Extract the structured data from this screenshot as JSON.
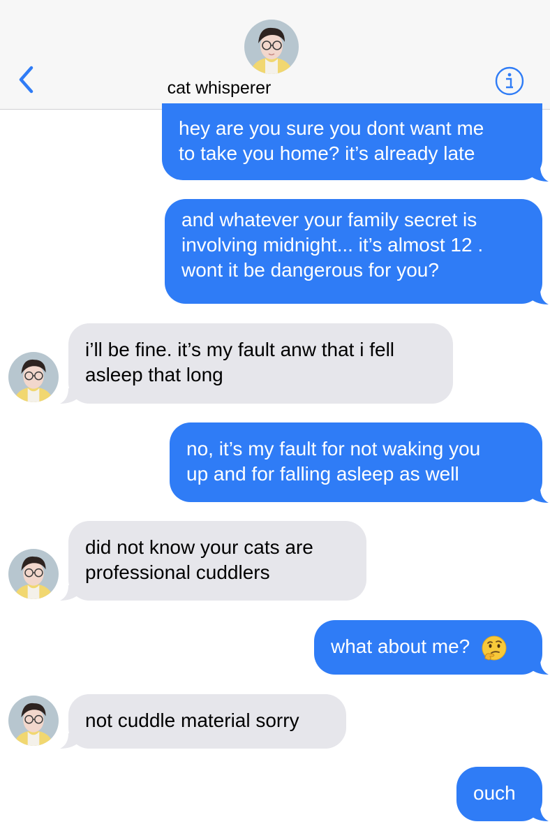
{
  "header": {
    "contact_name": "cat whisperer",
    "back_icon": "chevron-left-icon",
    "info_icon": "info-icon"
  },
  "colors": {
    "sent_bubble": "#2f7cf6",
    "received_bubble": "#e6e6eb",
    "accent": "#2f7cf6"
  },
  "messages": [
    {
      "from": "me",
      "text": "hey are you sure you dont want me\nto take you home? it’s already late"
    },
    {
      "from": "me",
      "text": "and whatever your family secret is\ninvolving midnight... it’s almost 12 .\nwont it be dangerous for you?"
    },
    {
      "from": "contact",
      "text": "i’ll be fine. it’s my fault anw that i fell\nasleep that long"
    },
    {
      "from": "me",
      "text": "no, it’s my fault for not waking you\nup and for falling asleep as well"
    },
    {
      "from": "contact",
      "text": "did not know your cats are\nprofessional cuddlers"
    },
    {
      "from": "me",
      "text": "what about me?",
      "emoji": "thinking-face-emoji"
    },
    {
      "from": "contact",
      "text": "not cuddle material sorry"
    },
    {
      "from": "me",
      "text": "ouch"
    }
  ]
}
